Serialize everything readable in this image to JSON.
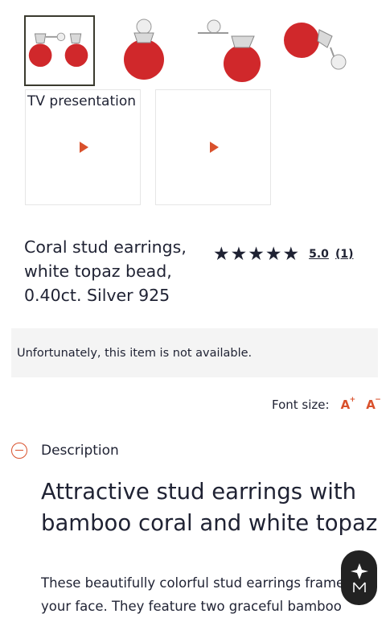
{
  "gallery": {
    "thumbnails": [
      {
        "alt": "coral-earrings-pair-icon",
        "selected": true
      },
      {
        "alt": "coral-earring-front-icon",
        "selected": false
      },
      {
        "alt": "coral-earring-side-icon",
        "selected": false
      },
      {
        "alt": "coral-earring-back-icon",
        "selected": false
      }
    ],
    "videos": [
      {
        "label": "TV presentation"
      },
      {
        "label": ""
      }
    ]
  },
  "product": {
    "title": "Coral stud earrings, white topaz bead, 0.40ct. Silver 925",
    "rating": {
      "value": "5.0",
      "count": "(1)",
      "stars": 5
    }
  },
  "availability": {
    "message": "Unfortunately, this item is not available."
  },
  "font_controls": {
    "label": "Font size:",
    "increase": "A",
    "increase_sup": "+",
    "decrease": "A",
    "decrease_sup": "−"
  },
  "description": {
    "section_label": "Description",
    "headline": "Attractive stud earrings with bamboo coral and white topaz",
    "body_line_1": "These beautifully colorful stud earrings frame",
    "body_line_2": "your face. They feature two graceful bamboo"
  },
  "colors": {
    "accent": "#d9512c",
    "text": "#1f2233",
    "coral": "#d0282b"
  }
}
